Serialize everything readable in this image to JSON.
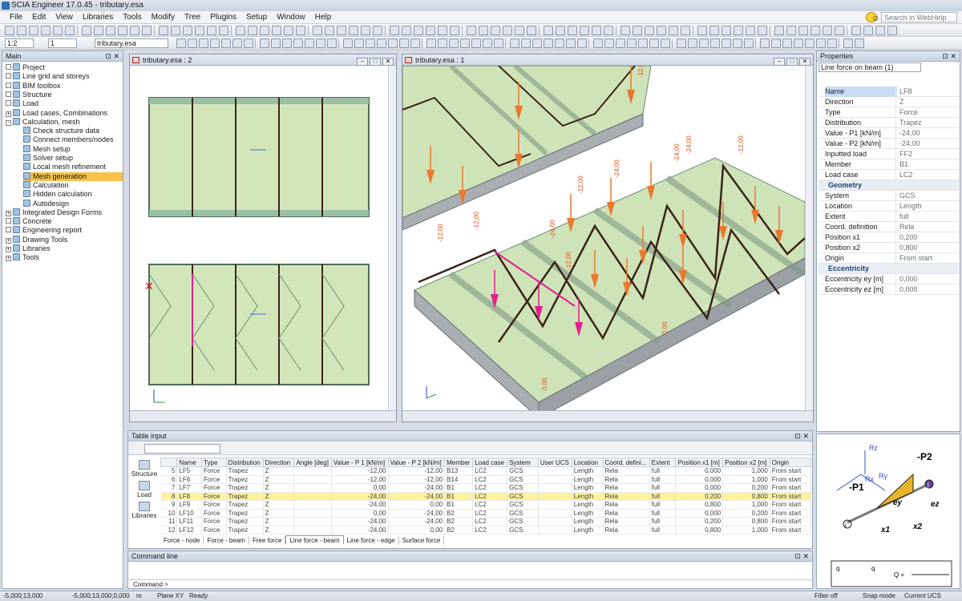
{
  "window": {
    "title": "SCIA Engineer 17.0.45 - tributary.esa"
  },
  "menu": [
    "File",
    "Edit",
    "View",
    "Libraries",
    "Tools",
    "Modify",
    "Tree",
    "Plugins",
    "Setup",
    "Window",
    "Help"
  ],
  "help_search": {
    "placeholder": "Search in WebHelp"
  },
  "toolbar2": {
    "combo1": "1:2",
    "combo2": "1",
    "project_combo": "tributary.esa"
  },
  "main_panel": {
    "title": "Main",
    "items": [
      {
        "label": "Project",
        "indent": 0,
        "exp": ""
      },
      {
        "label": "Line grid and storeys",
        "indent": 0,
        "exp": ""
      },
      {
        "label": "BIM toolbox",
        "indent": 0,
        "exp": ""
      },
      {
        "label": "Structure",
        "indent": 0,
        "exp": ""
      },
      {
        "label": "Load",
        "indent": 0,
        "exp": ""
      },
      {
        "label": "Load cases, Combinations",
        "indent": 0,
        "exp": "+"
      },
      {
        "label": "Calculation, mesh",
        "indent": 0,
        "exp": "-"
      },
      {
        "label": "Check structure data",
        "indent": 1,
        "exp": ""
      },
      {
        "label": "Connect members/nodes",
        "indent": 1,
        "exp": ""
      },
      {
        "label": "Mesh setup",
        "indent": 1,
        "exp": ""
      },
      {
        "label": "Solver setup",
        "indent": 1,
        "exp": ""
      },
      {
        "label": "Local mesh refinement",
        "indent": 1,
        "exp": ""
      },
      {
        "label": "Mesh generation",
        "indent": 1,
        "exp": "",
        "selected": true
      },
      {
        "label": "Calculation",
        "indent": 1,
        "exp": ""
      },
      {
        "label": "Hidden calculation",
        "indent": 1,
        "exp": ""
      },
      {
        "label": "Autodesign",
        "indent": 1,
        "exp": ""
      },
      {
        "label": "Integrated Design Forms",
        "indent": 0,
        "exp": "+"
      },
      {
        "label": "Concrete",
        "indent": 0,
        "exp": ""
      },
      {
        "label": "Engineering report",
        "indent": 0,
        "exp": ""
      },
      {
        "label": "Drawing Tools",
        "indent": 0,
        "exp": "+"
      },
      {
        "label": "Libraries",
        "indent": 0,
        "exp": "+"
      },
      {
        "label": "Tools",
        "indent": 0,
        "exp": "+"
      }
    ]
  },
  "view_left": {
    "title": "tributary.esa : 2"
  },
  "view_right": {
    "title": "tributary.esa : 1"
  },
  "load_labels": [
    "-12,00",
    "-24,00",
    "-24,00",
    "-12,00",
    "-12,00",
    "-12,00",
    "-24,00",
    "-24,00",
    "-12,00",
    "-12,00",
    "0,00",
    "0,00"
  ],
  "properties": {
    "title": "Properties",
    "selector": "Line force on beam (1)",
    "rows": [
      {
        "k": "Name",
        "v": "LF8",
        "sel": true
      },
      {
        "k": "Direction",
        "v": "Z"
      },
      {
        "k": "Type",
        "v": "Force"
      },
      {
        "k": "Distribution",
        "v": "Trapez"
      },
      {
        "k": "Value - P1 [kN/m]",
        "v": "-24,00"
      },
      {
        "k": "Value - P2 [kN/m]",
        "v": "-24,00"
      },
      {
        "k": "Inputted load",
        "v": "FF2"
      },
      {
        "k": "Member",
        "v": "B1"
      },
      {
        "k": "Load case",
        "v": "LC2"
      },
      {
        "k": "Geometry",
        "v": "",
        "cat": true
      },
      {
        "k": "System",
        "v": "GCS"
      },
      {
        "k": "Location",
        "v": "Length"
      },
      {
        "k": "Extent",
        "v": "full"
      },
      {
        "k": "Coord. definition",
        "v": "Rela"
      },
      {
        "k": "Position x1",
        "v": "0,200"
      },
      {
        "k": "Position x2",
        "v": "0,800"
      },
      {
        "k": "Origin",
        "v": "From start"
      },
      {
        "k": "Eccentricity",
        "v": "",
        "cat": true
      },
      {
        "k": "Eccentricity ey [m]",
        "v": "0,000"
      },
      {
        "k": "Eccentricity ez [m]",
        "v": "0,000"
      }
    ]
  },
  "diagram": {
    "labels": {
      "p1": "-P1",
      "p2": "-P2",
      "ey": "ey",
      "ez": "ez",
      "x1": "x1",
      "x2": "x2",
      "i": "i",
      "j": "j",
      "rx": "Rx",
      "ry": "Ry",
      "rz": "Rz"
    },
    "formula": {
      "qmax": "q",
      "qmin": "q",
      "max_sub": "max",
      "min_sub": "min",
      "q": "Q ="
    }
  },
  "table_input": {
    "title": "Table input",
    "side": [
      "Structure",
      "Load",
      "Libraries"
    ],
    "columns": [
      "",
      "Name",
      "Type",
      "Distribution",
      "Direction",
      "Angle [deg]",
      "Value - P 1 [kN/m]",
      "Value - P 2 [kN/m]",
      "Member",
      "Load case",
      "System",
      "User UCS",
      "Location",
      "Coord. defini...",
      "Extent",
      "Position x1 [m]",
      "Position x2 [m]",
      "Origin"
    ],
    "rows": [
      [
        "5",
        "LF5",
        "Force",
        "Trapez",
        "Z",
        "",
        "-12,00",
        "-12,00",
        "B13",
        "LC2",
        "GCS",
        "",
        "Length",
        "Rela",
        "full",
        "0,000",
        "1,000",
        "From start"
      ],
      [
        "6",
        "LF6",
        "Force",
        "Trapez",
        "Z",
        "",
        "-12,00",
        "-12,00",
        "B14",
        "LC2",
        "GCS",
        "",
        "Length",
        "Rela",
        "full",
        "0,000",
        "1,000",
        "From start"
      ],
      [
        "7",
        "LF7",
        "Force",
        "Trapez",
        "Z",
        "",
        "0,00",
        "-24,00",
        "B1",
        "LC2",
        "GCS",
        "",
        "Length",
        "Rela",
        "full",
        "0,000",
        "0,200",
        "From start"
      ],
      [
        "8",
        "LF8",
        "Force",
        "Trapez",
        "Z",
        "",
        "-24,00",
        "-24,00",
        "B1",
        "LC2",
        "GCS",
        "",
        "Length",
        "Rela",
        "full",
        "0,200",
        "0,800",
        "From start"
      ],
      [
        "9",
        "LF9",
        "Force",
        "Trapez",
        "Z",
        "",
        "-24,00",
        "0,00",
        "B1",
        "LC2",
        "GCS",
        "",
        "Length",
        "Rela",
        "full",
        "0,800",
        "1,000",
        "From start"
      ],
      [
        "10",
        "LF10",
        "Force",
        "Trapez",
        "Z",
        "",
        "0,00",
        "-24,00",
        "B2",
        "LC2",
        "GCS",
        "",
        "Length",
        "Rela",
        "full",
        "0,000",
        "0,200",
        "From start"
      ],
      [
        "11",
        "LF11",
        "Force",
        "Trapez",
        "Z",
        "",
        "-24,00",
        "-24,00",
        "B2",
        "LC2",
        "GCS",
        "",
        "Length",
        "Rela",
        "full",
        "0,200",
        "0,800",
        "From start"
      ],
      [
        "12",
        "LF12",
        "Force",
        "Trapez",
        "Z",
        "",
        "-24,00",
        "0,00",
        "B2",
        "LC2",
        "GCS",
        "",
        "Length",
        "Rela",
        "full",
        "0,800",
        "1,000",
        "From start"
      ]
    ],
    "selected_index": 3,
    "tabs": [
      "Force - node",
      "Force - beam",
      "Free force",
      "Line force - beam",
      "Line force - edge",
      "Surface force"
    ],
    "active_tab": 3
  },
  "command_line": {
    "title": "Command line",
    "prompt": "Command >"
  },
  "status": {
    "coords1": "-5,000;13,000",
    "coords2": "-5,000;13,000;0,000",
    "unit": "m",
    "plane": "Plane XY",
    "state": "Ready",
    "filter": "Filter off",
    "snap": "Snap mode",
    "ucs": "Current UCS"
  },
  "colors": {
    "accent": "#f6c24a",
    "load": "#e8792f",
    "slab": "#cfe3b8",
    "beam": "#4a2a1a",
    "selected_load": "#e0208a"
  }
}
